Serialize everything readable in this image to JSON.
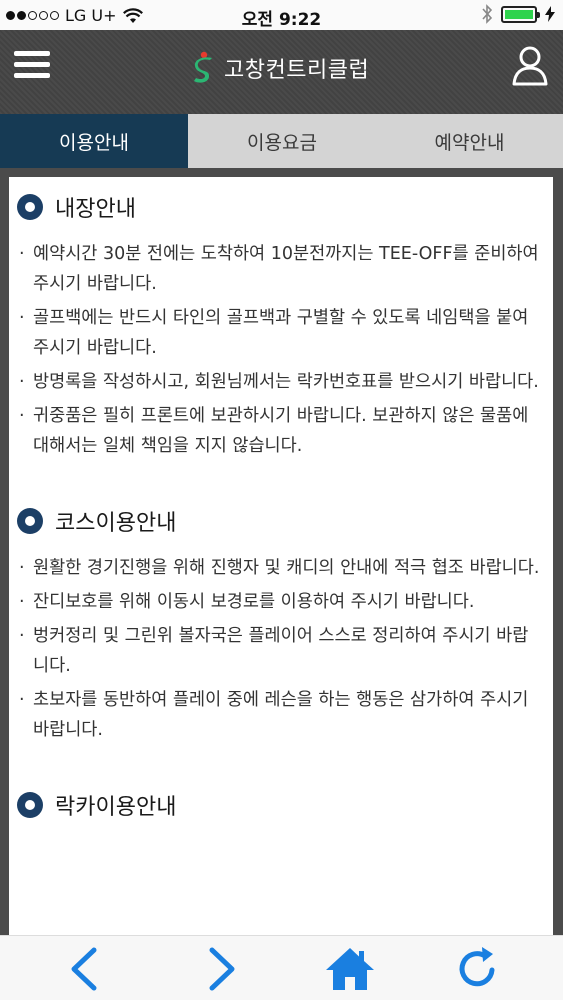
{
  "status_bar": {
    "carrier": "LG U+",
    "time": "오전 9:22",
    "battery_level": 1.0
  },
  "header": {
    "brand_name": "고창컨트리클럽",
    "menu_icon": "hamburger-menu-icon",
    "user_icon": "user-icon"
  },
  "tabs": [
    {
      "label": "이용안내",
      "active": true
    },
    {
      "label": "이용요금",
      "active": false
    },
    {
      "label": "예약안내",
      "active": false
    }
  ],
  "sections": [
    {
      "title": "내장안내",
      "items": [
        "예약시간 30분 전에는 도착하여 10분전까지는 TEE-OFF를 준비하여 주시기 바랍니다.",
        "골프백에는 반드시 타인의 골프백과 구별할 수 있도록 네임택을 붙여주시기 바랍니다.",
        "방명록을 작성하시고, 회원님께서는 락카번호표를 받으시기 바랍니다.",
        "귀중품은 필히 프론트에 보관하시기 바랍니다. 보관하지 않은 물품에 대해서는 일체 책임을 지지 않습니다."
      ]
    },
    {
      "title": "코스이용안내",
      "items": [
        "원활한 경기진행을 위해 진행자 및 캐디의 안내에 적극 협조 바랍니다.",
        "잔디보호를 위해 이동시 보경로를 이용하여 주시기 바랍니다.",
        "벙커정리 및 그린위 볼자국은 플레이어 스스로 정리하여 주시기 바랍니다.",
        "초보자를 동반하여 플레이 중에 레슨을 하는 행동은 삼가하여 주시기 바랍니다."
      ]
    },
    {
      "title": "락카이용안내",
      "items": []
    }
  ],
  "toolbar": {
    "back_icon": "back-arrow-icon",
    "forward_icon": "forward-arrow-icon",
    "home_icon": "home-icon",
    "reload_icon": "reload-icon"
  },
  "colors": {
    "header_bg": "#444444",
    "active_tab_bg": "#163a54",
    "inactive_tab_bg": "#d4d4d4",
    "section_bullet": "#1c3f66",
    "toolbar_icon": "#1a7fe0",
    "brand_green": "#2bb673",
    "brand_red": "#e63b2e"
  }
}
